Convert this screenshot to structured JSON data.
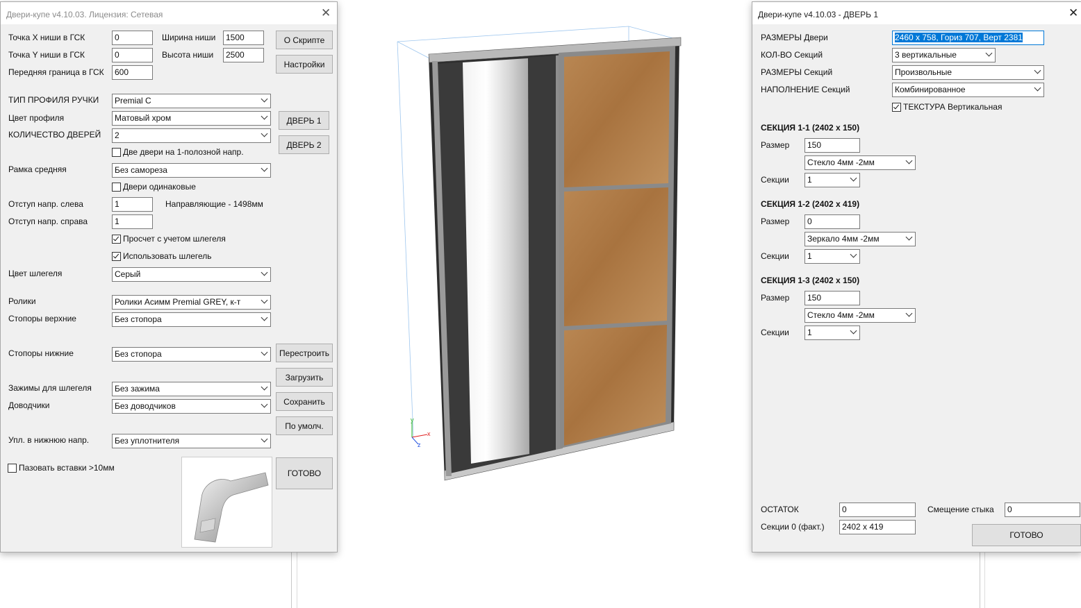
{
  "left_window": {
    "title": "Двери-купе v4.10.03.  Лицензия: Сетевая",
    "close_glyph": "✕",
    "labels": {
      "niche_x": "Точка X ниши в ГСК",
      "niche_y": "Точка Y ниши в ГСК",
      "front_border": "Передняя граница в ГСК",
      "niche_width": "Ширина ниши",
      "niche_height": "Высота ниши",
      "handle_profile_type": "ТИП ПРОФИЛЯ РУЧКИ",
      "profile_color": "Цвет профиля",
      "door_count": "КОЛИЧЕСТВО ДВЕРЕЙ",
      "middle_frame": "Рамка средняя",
      "offset_left": "Отступ напр. слева",
      "offset_right": "Отступ напр. справа",
      "guides_info": "Направляющие - 1498мм",
      "schlegel_color": "Цвет шлегеля",
      "rollers": "Ролики",
      "stoppers_top": "Стопоры верхние",
      "stoppers_bottom": "Стопоры нижние",
      "schlegel_clamps": "Зажимы для шлегеля",
      "closers": "Доводчики",
      "bottom_seal": "Упл. в нижнюю напр."
    },
    "values": {
      "niche_x": "0",
      "niche_y": "0",
      "front_border": "600",
      "niche_width": "1500",
      "niche_height": "2500",
      "offset_left": "1",
      "offset_right": "1"
    },
    "dropdowns": {
      "handle_profile_type": "Premial C",
      "profile_color": "Матовый хром",
      "door_count": "2",
      "middle_frame": "Без самореза",
      "schlegel_color": "Серый",
      "rollers": "Ролики Асимм Premial GREY, к-т",
      "stoppers_top": "Без стопора",
      "stoppers_bottom": "Без стопора",
      "schlegel_clamps": "Без зажима",
      "closers": "Без доводчиков",
      "bottom_seal": "Без уплотнителя"
    },
    "checkboxes": {
      "two_doors_one_rail": {
        "label": "Две двери на 1-полозной напр.",
        "checked": false
      },
      "same_doors": {
        "label": "Двери одинаковые",
        "checked": false
      },
      "calc_schlegel": {
        "label": "Просчет с учетом шлегеля",
        "checked": true
      },
      "use_schlegel": {
        "label": "Использовать шлегель",
        "checked": true
      },
      "groove_inserts": {
        "label": "Пазовать вставки >10мм",
        "checked": false
      }
    },
    "buttons": {
      "about": "О Скрипте",
      "settings": "Настройки",
      "door1": "ДВЕРЬ 1",
      "door2": "ДВЕРЬ 2",
      "rebuild": "Перестроить",
      "load": "Загрузить",
      "save": "Сохранить",
      "defaults": "По умолч.",
      "done": "ГОТОВО"
    }
  },
  "viewport": {
    "axes": {
      "x": "x",
      "y": "y",
      "z": "z"
    },
    "colors": {
      "oak": "#b07e4c",
      "dark_panel": "#3b3b3b",
      "frame": "#8c8c8c",
      "mirror": "#e8e8e8"
    }
  },
  "right_window": {
    "title": "Двери-купе v4.10.03  -  ДВЕРЬ 1",
    "close_glyph": "✕",
    "labels": {
      "door_size": "РАЗМЕРЫ Двери",
      "section_count": "КОЛ-ВО Секций",
      "section_sizes": "РАЗМЕРЫ Секций",
      "section_fill": "НАПОЛНЕНИЕ Секций",
      "remainder": "ОСТАТОК",
      "joint_offset": "Смещение стыка",
      "section0_fact": "Секции 0 (факт.)"
    },
    "door_size_value": "2460 x 758, Гориз 707, Верт 2381",
    "dropdowns": {
      "section_count": "3 вертикальные",
      "section_sizes": "Произвольные",
      "section_fill": "Комбинированное"
    },
    "texture_checkbox": {
      "label": "ТЕКСТУРА Вертикальная",
      "checked": true
    },
    "sections": [
      {
        "title": "СЕКЦИЯ 1-1   (2402 x 150)",
        "size_label": "Размер",
        "size": "150",
        "material": "Стекло 4мм -2мм",
        "sub_label": "Секции",
        "sub_count": "1"
      },
      {
        "title": "СЕКЦИЯ 1-2   (2402 x 419)",
        "size_label": "Размер",
        "size": "0",
        "material": "Зеркало 4мм -2мм",
        "sub_label": "Секции",
        "sub_count": "1"
      },
      {
        "title": "СЕКЦИЯ 1-3   (2402 x 150)",
        "size_label": "Размер",
        "size": "150",
        "material": "Стекло 4мм -2мм",
        "sub_label": "Секции",
        "sub_count": "1"
      }
    ],
    "remainder_value": "0",
    "joint_offset_value": "0",
    "section0_fact_value": "2402 x 419",
    "done_button": "ГОТОВО"
  }
}
